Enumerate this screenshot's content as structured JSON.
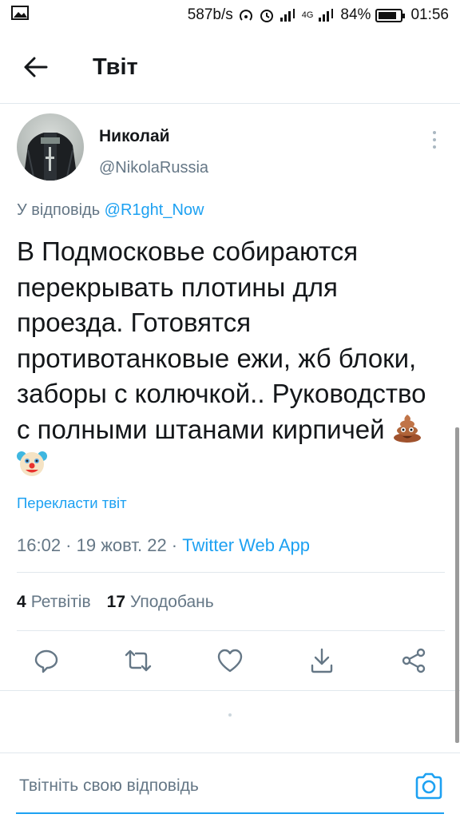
{
  "status_bar": {
    "network_speed": "587b/s",
    "network_type": "4G",
    "battery_percent": "84%",
    "time": "01:56"
  },
  "header": {
    "title": "Твіт"
  },
  "tweet": {
    "author_name": "Николай",
    "author_handle": "@NikolaRussia",
    "reply_prefix": "У відповідь ",
    "reply_to": "@R1ght_Now",
    "text": "В Подмосковье собираются перекрывать плотины для проезда. Готовятся противотанковые ежи, жб блоки, заборы с колючкой.. Руководство с полными штанами кирпичей",
    "translate_label": "Перекласти твіт",
    "timestamp": "16:02 · 19 жовт. 22 · ",
    "source": "Twitter Web App",
    "retweets_count": "4",
    "retweets_label": "Ретвітів",
    "likes_count": "17",
    "likes_label": "Уподобань"
  },
  "actions": [
    "reply-icon",
    "retweet-icon",
    "like-icon",
    "bookmark-download-icon",
    "share-icon"
  ],
  "composer": {
    "placeholder": "Твітніть свою відповідь"
  },
  "colors": {
    "accent": "#1da1f2",
    "secondary_text": "#657786",
    "divider": "#e1e8ed"
  }
}
